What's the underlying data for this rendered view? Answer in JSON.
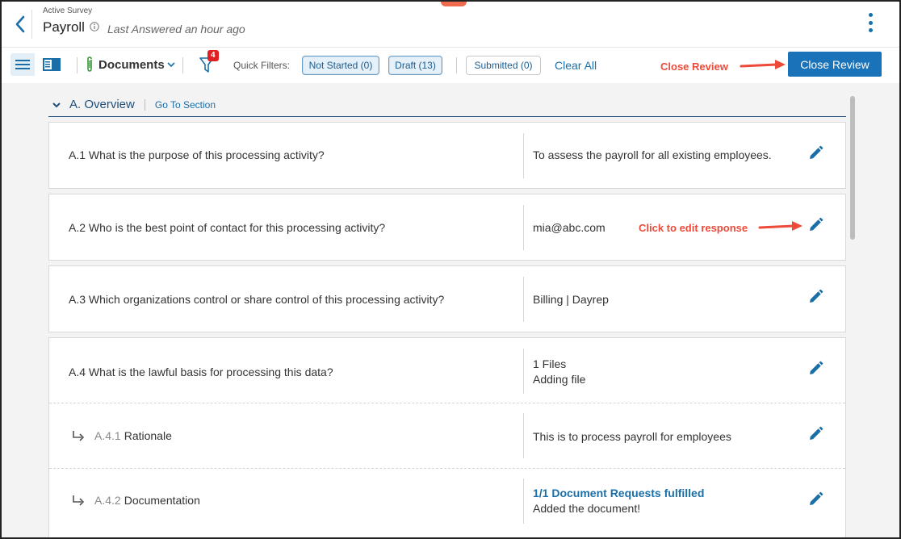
{
  "header": {
    "survey_label": "Active Survey",
    "title": "Payroll",
    "last_answered": "Last Answered an hour ago"
  },
  "toolbar": {
    "documents_label": "Documents",
    "filter_badge": "4",
    "quick_filters_label": "Quick Filters:",
    "chips": {
      "not_started": "Not Started (0)",
      "draft": "Draft (13)",
      "submitted": "Submitted (0)"
    },
    "clear_all": "Clear All",
    "close_review": "Close Review"
  },
  "annotations": {
    "close_review": "Close Review",
    "edit_response": "Click to edit response"
  },
  "section": {
    "title": "A. Overview",
    "goto": "Go To Section"
  },
  "questions": [
    {
      "q": "A.1 What is the purpose of this processing activity?",
      "a": "To assess the payroll for all existing employees."
    },
    {
      "q": "A.2 Who is the best point of contact for this processing activity?",
      "a": "mia@abc.com"
    },
    {
      "q": "A.3 Which organizations  control or share control of this processing activity?",
      "a": "Billing | Dayrep"
    },
    {
      "q": "A.4 What is the lawful basis for processing this data?",
      "a1": "1 Files",
      "a2": "Adding file",
      "sub": [
        {
          "num": "A.4.1",
          "label": "Rationale",
          "a": "This is to process payroll for employees"
        },
        {
          "num": "A.4.2",
          "label": "Documentation",
          "a_link": "1/1 Document Requests fulfilled",
          "a": "Added the document!"
        }
      ]
    }
  ],
  "colors": {
    "accent": "#1a73b8",
    "annotation": "#ee4a3a",
    "badge": "#e02020"
  }
}
